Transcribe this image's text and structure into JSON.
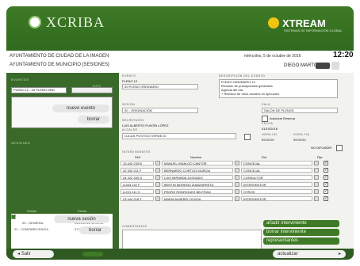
{
  "header": {
    "logo_left": "XCRIBA",
    "logo_right": "XTREAM",
    "logo_right_sub": "SISTEMAS DE INFORMACIÓN GLOBAL"
  },
  "top": {
    "title1": "AYUNTAMIENTO DE CIUDAD DE LA IMAGEN",
    "title2": "AYUNTAMIENTO DE MUNICIPIO [SESIONES]",
    "date": "miércoles, 5 de octubre de 2016",
    "time": "12:20",
    "user": "DIEGO MARTORELL"
  },
  "left": {
    "eventos_label": "EVENTOS",
    "tipo_label": "TIPO",
    "selected_event": "PLENO 12 - 00 PLENO ORD",
    "new_event": "nuevo evento",
    "delete": "borrar",
    "sesiones_label": "SESIONES",
    "session_cols": [
      "Sesión",
      "Fecha"
    ],
    "sessions": [
      {
        "sesion": "00 - ORIGINACIÓN",
        "fecha": "01/10/2016 9:00:00",
        "selected": true
      },
      {
        "sesion": "03 - GENERAL",
        "fecha": "06/10/2016 11:00:00",
        "selected": false
      },
      {
        "sesion": "01 - COMPARECENCIA",
        "fecha": "07/10/2016 15:00:00",
        "selected": false
      }
    ],
    "new_session": "nueva sesión",
    "delete2": "borrar",
    "exit": "Salir"
  },
  "main": {
    "evento_label": "EVENTO",
    "evento_val": "PLENO 12",
    "evento_select": "00 PLENO ORDINARIO",
    "events_desc_label": "DESCRIPCIÓN DEL EVENTO",
    "events_desc": [
      "PLENO ORDINARIO 12",
      "Revisión de presupuestos generales",
      "Agenda del día",
      "+ Revisión de otros asuntos en ejecución"
    ],
    "sesion_label": "SESIÓN",
    "sesion_val": "00 - ORIGINACIÓN",
    "secretario_label": "SECRETARIO",
    "secretario_val": "LUIS ALBERTO PUNTÍN LÓPEZ",
    "alcalde_label": "ALCALDE",
    "alcalde_val": "LUCAS POSTIGO VERDEJO",
    "sala_label": "SALA",
    "sala_val": "SALÓN DE PLENOS",
    "autorizar": "Autorizar Reserva",
    "fecha_label": "FECHA",
    "fecha_val": "01/10/2016",
    "hora_ini_label": "HORA INI",
    "hora_ini": "09:00:00",
    "hora_fin_label": "HORA FIN",
    "hora_fin": "09:00:00",
    "no_difundir": "NO DIFUNDIR",
    "intervinientes_label": "INTERVINIENTES",
    "cols": [
      "DNI",
      "Nombre",
      "Rol",
      "Fija"
    ],
    "rows": [
      {
        "dni": "13 443 233 B",
        "nombre": "MANUEL HIDALGO CANTOR",
        "rol": "CONCEJAL",
        "fija": true
      },
      {
        "dni": "32 332 211 F",
        "nombre": "BERNARDO CORTIJO MURCIA",
        "rol": "CONCEJAL",
        "fija": true
      },
      {
        "dni": "44 322 333 G",
        "nombre": "LUIS MIRANDA JUSGADO",
        "rol": "CONSULTOR",
        "fija": true
      },
      {
        "dni": "A 543 222 F",
        "nombre": "BERTIN MORENO ZUBIZARRETA",
        "rol": "INTERVENTOR",
        "fija": true
      },
      {
        "dni": "A 221 111 G",
        "nombre": "PEDRO RODRIGUEZ BELTRAN",
        "rol": "OTROS",
        "fija": true
      },
      {
        "dni": "23 444 218 T",
        "nombre": "MARIA ALBERDI OCHOA",
        "rol": "INTERVENTOR",
        "fija": true
      }
    ],
    "comentarios": "COMENTARIOS",
    "btn_add": "añadir interviniente",
    "btn_del": "borrar interviniente",
    "btn_rep": "representantes",
    "btn_update": "actualizar"
  }
}
